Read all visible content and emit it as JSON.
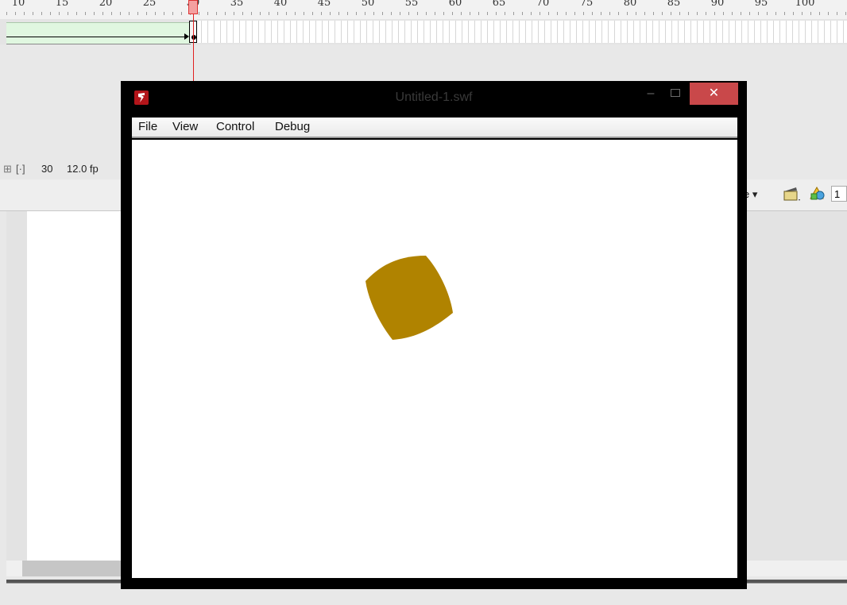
{
  "timeline": {
    "ruler_labels": [
      "10",
      "15",
      "20",
      "25",
      "30",
      "35",
      "40",
      "45",
      "50",
      "55",
      "60",
      "65",
      "70",
      "75",
      "80",
      "85",
      "90",
      "95",
      "100"
    ],
    "current_frame": "30",
    "frame_rate": "12.0 fp",
    "current_frame_label": "30"
  },
  "edit_bar": {
    "clip_tail": "e ▾",
    "zoom_field_value": "1"
  },
  "player": {
    "title": "Untitled-1.swf",
    "minimize_glyph": "–",
    "close_glyph": "✕",
    "menu": [
      "File",
      "View",
      "Control",
      "Debug"
    ],
    "shape_color": "#b08300"
  },
  "colors": {
    "close_button": "#c9484a",
    "tween_span": "#e0f7e0",
    "playhead": "#e02020"
  }
}
